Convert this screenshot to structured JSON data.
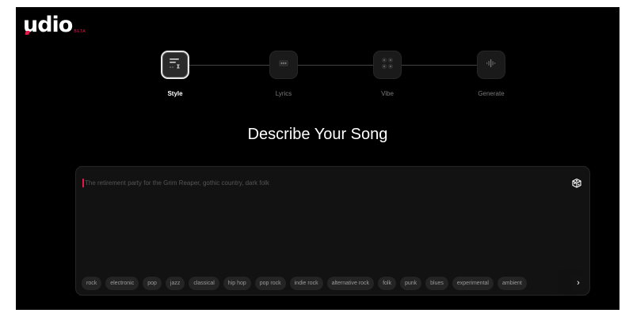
{
  "brand": {
    "name": "udio",
    "badge": "BETA"
  },
  "steps": [
    {
      "label": "Style",
      "icon": "style-icon",
      "active": true
    },
    {
      "label": "Lyrics",
      "icon": "lyrics-icon",
      "active": false
    },
    {
      "label": "Vibe",
      "icon": "vibe-icon",
      "active": false
    },
    {
      "label": "Generate",
      "icon": "waveform-icon",
      "active": false
    }
  ],
  "heading": "Describe Your Song",
  "prompt": {
    "placeholder": "The retirement party for the Grim Reaper, gothic country, dark folk"
  },
  "tags": [
    "rock",
    "electronic",
    "pop",
    "jazz",
    "classical",
    "hip hop",
    "pop rock",
    "indie rock",
    "alternative rock",
    "folk",
    "punk",
    "blues",
    "experimental",
    "ambient"
  ],
  "tags_next": "›",
  "colors": {
    "accent": "#e3194a",
    "background": "#000000",
    "panel": "#121212"
  }
}
